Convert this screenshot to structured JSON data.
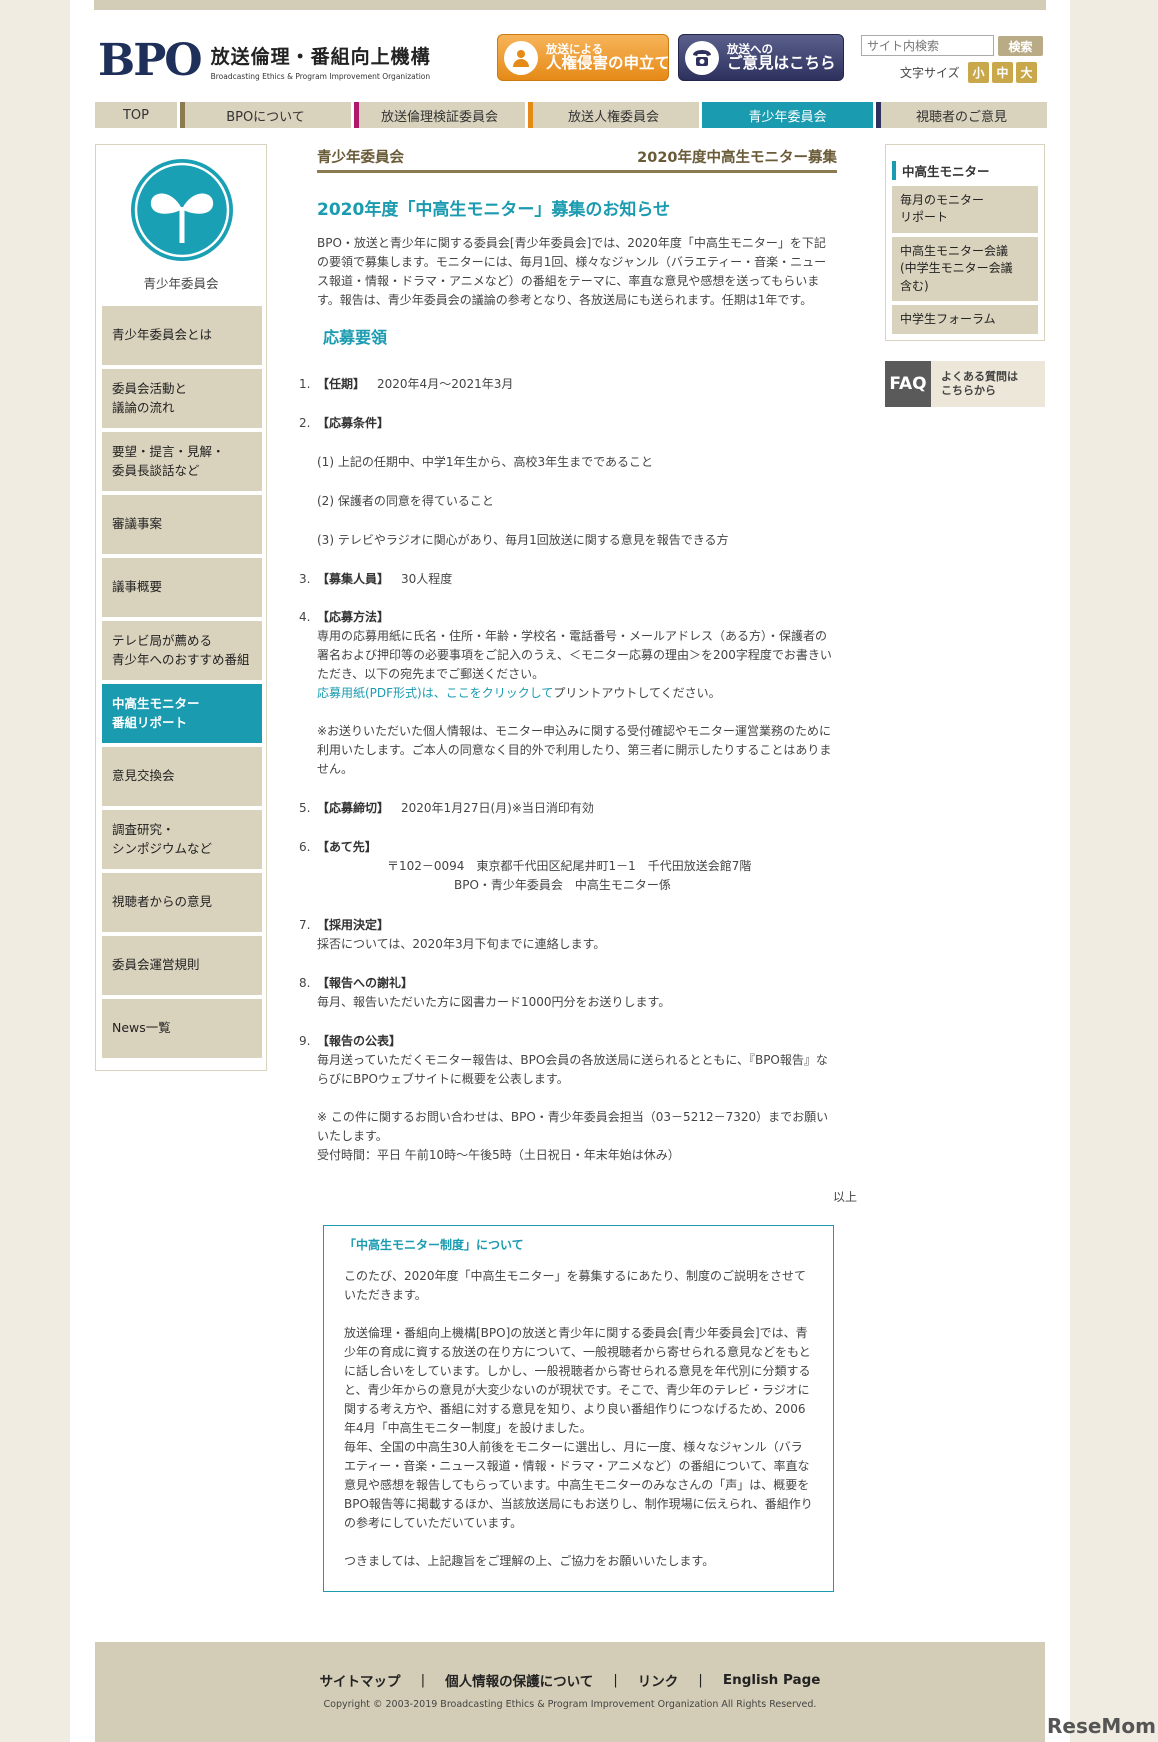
{
  "header": {
    "logo_mark": "BPO",
    "logo_jp": "放送倫理・番組向上機構",
    "logo_en": "Broadcasting Ethics & Program Improvement Organization",
    "btn_human_rights_line1": "放送による",
    "btn_human_rights_line2": "人権侵害の申立て",
    "btn_opinion_line1": "放送への",
    "btn_opinion_line2": "ご意見はこちら",
    "search_placeholder": "サイト内検索",
    "search_button": "検索",
    "font_size_label": "文字サイズ",
    "font_small": "小",
    "font_medium": "中",
    "font_large": "大"
  },
  "global_nav": [
    {
      "label": "TOP",
      "color": ""
    },
    {
      "label": "BPOについて",
      "color": "#8c7a52"
    },
    {
      "label": "放送倫理検証委員会",
      "color": "#b0186c"
    },
    {
      "label": "放送人権委員会",
      "color": "#e58a17"
    },
    {
      "label": "青少年委員会",
      "color": "#1a9bb0"
    },
    {
      "label": "視聴者のご意見",
      "color": "#2e315e"
    }
  ],
  "left_sidebar": {
    "title": "青少年委員会",
    "items": [
      "青少年委員会とは",
      "委員会活動と\n議論の流れ",
      "要望・提言・見解・\n委員長談話など",
      "審議事案",
      "議事概要",
      "テレビ局が薦める\n青少年へのおすすめ番組",
      "中高生モニター\n番組リポート",
      "意見交換会",
      "調査研究・\nシンポジウムなど",
      "視聴者からの意見",
      "委員会運営規則",
      "News一覧"
    ]
  },
  "main": {
    "header_left": "青少年委員会",
    "header_right": "2020年度中高生モニター募集",
    "title": "2020年度「中高生モニター」募集のお知らせ",
    "lead": "BPO・放送と青少年に関する委員会[青少年委員会]では、2020年度「中高生モニター」を下記の要領で募集します。モニターには、毎月1回、様々なジャンル（バラエティー・音楽・ニュース報道・情報・ドラマ・アニメなど）の番組をテーマに、率直な意見や感想を送ってもらいます。報告は、青少年委員会の議論の参考となり、各放送局にも送られます。任期は1年です。",
    "subtitle": "応募要領",
    "s1_num": "1.",
    "s1_label": "【任期】",
    "s1_value": "2020年4月～2021年3月",
    "s2_num": "2.",
    "s2_label": "【応募条件】",
    "s2_c1": "(1) 上記の任期中、中学1年生から、高校3年生までであること",
    "s2_c2": "(2) 保護者の同意を得ていること",
    "s2_c3": "(3) テレビやラジオに関心があり、毎月1回放送に関する意見を報告できる方",
    "s3_num": "3.",
    "s3_label": "【募集人員】",
    "s3_value": "30人程度",
    "s4_num": "4.",
    "s4_label": "【応募方法】",
    "s4_body": "専用の応募用紙に氏名・住所・年齢・学校名・電話番号・メールアドレス（ある方）・保護者の署名および押印等の必要事項をご記入のうえ、＜モニター応募の理由＞を200字程度でお書きいただき、以下の宛先までご郵送ください。",
    "s4_link": "応募用紙(PDF形式)は、ここをクリックして",
    "s4_link_after": "プリントアウトしてください。",
    "s4_note": "※お送りいただいた個人情報は、モニター申込みに関する受付確認やモニター運営業務のために利用いたします。ご本人の同意なく目的外で利用したり、第三者に開示したりすることはありません。",
    "s5_num": "5.",
    "s5_label": "【応募締切】",
    "s5_value": "2020年1月27日(月)※当日消印有効",
    "s6_num": "6.",
    "s6_label": "【あて先】",
    "s6_addr1": "〒102－0094　東京都千代田区紀尾井町1－1　千代田放送会館7階",
    "s6_addr2": "BPO・青少年委員会　中高生モニター係",
    "s7_num": "7.",
    "s7_label": "【採用決定】",
    "s7_body": "採否については、2020年3月下旬までに連絡します。",
    "s8_num": "8.",
    "s8_label": "【報告への謝礼】",
    "s8_body": "毎月、報告いただいた方に図書カード1000円分をお送りします。",
    "s9_num": "9.",
    "s9_label": "【報告の公表】",
    "s9_body": "毎月送っていただくモニター報告は、BPO会員の各放送局に送られるとともに、『BPO報告』ならびにBPOウェブサイトに概要を公表します。",
    "s9_contact": "※ この件に関するお問い合わせは、BPO・青少年委員会担当（03－5212－7320）までお願いいたします。",
    "s9_hours": "受付時間：平日 午前10時～午後5時（土日祝日・年末年始は休み）",
    "ijo": "以上",
    "box_title": "「中高生モニター制度」について",
    "box_p1": "このたび、2020年度「中高生モニター」を募集するにあたり、制度のご説明をさせていただきます。",
    "box_p2": "放送倫理・番組向上機構[BPO]の放送と青少年に関する委員会[青少年委員会]では、青少年の育成に資する放送の在り方について、一般視聴者から寄せられる意見などをもとに話し合いをしています。しかし、一般視聴者から寄せられる意見を年代別に分類すると、青少年からの意見が大変少ないのが現状です。そこで、青少年のテレビ・ラジオに関する考え方や、番組に対する意見を知り、より良い番組作りにつなげるため、2006年4月「中高生モニター制度」を設けました。",
    "box_p3": "毎年、全国の中高生30人前後をモニターに選出し、月に一度、様々なジャンル（バラエティー・音楽・ニュース報道・情報・ドラマ・アニメなど）の番組について、率直な意見や感想を報告してもらっています。中高生モニターのみなさんの「声」は、概要をBPO報告等に掲載するほか、当該放送局にもお送りし、制作現場に伝えられ、番組作りの参考にしていただいています。",
    "box_p4": "つきましては、上記趣旨をご理解の上、ご協力をお願いいたします。"
  },
  "right_sidebar": {
    "title": "中高生モニター",
    "items": [
      "毎月のモニター\nリポート",
      "中高生モニター会議\n(中学生モニター会議\n含む)",
      "中学生フォーラム"
    ],
    "faq_icon": "FAQ",
    "faq_text": "よくある質問は\nこちらから"
  },
  "footer": {
    "links": [
      "サイトマップ",
      "個人情報の保護について",
      "リンク",
      "English Page"
    ],
    "separator": "|",
    "copyright": "Copyright © 2003-2019 Broadcasting Ethics & Program Improvement Organization All Rights Reserved."
  },
  "watermark": "ReseMom"
}
